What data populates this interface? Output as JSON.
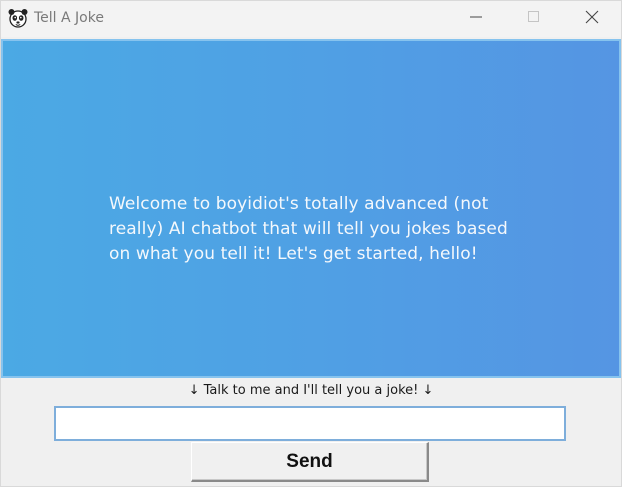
{
  "window": {
    "title": "Tell A Joke",
    "icon": "panda-icon",
    "controls": [
      "minimize-icon",
      "maximize-icon",
      "close-icon"
    ]
  },
  "chat": {
    "message": "Welcome to boyidiot's totally advanced (not really) AI chatbot that will tell you jokes based on what you tell it! Let's get started, hello!",
    "gradient_start": "#4ba9e4",
    "gradient_end": "#5595e3"
  },
  "prompt": {
    "label": "↓ Talk to me and I'll tell you a joke! ↓"
  },
  "input": {
    "value": "",
    "placeholder": ""
  },
  "send_button": {
    "label": "Send"
  }
}
